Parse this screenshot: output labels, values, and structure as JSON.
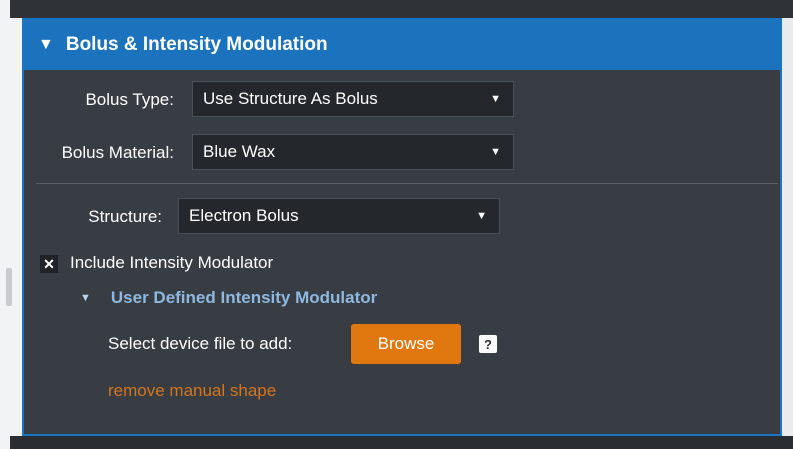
{
  "panel": {
    "title": "Bolus & Intensity Modulation",
    "collapse_icon": "triangle-down-icon"
  },
  "bolus_type": {
    "label": "Bolus Type:",
    "value": "Use Structure As Bolus"
  },
  "bolus_material": {
    "label": "Bolus Material:",
    "value": "Blue Wax"
  },
  "structure": {
    "label": "Structure:",
    "value": "Electron Bolus"
  },
  "include_modulator": {
    "checked": true,
    "label": "Include Intensity Modulator"
  },
  "modulator": {
    "title": "User Defined Intensity Modulator",
    "device_label": "Select device file to add:",
    "browse_label": "Browse",
    "help_label": "?",
    "remove_link": "remove manual shape"
  },
  "colors": {
    "header_blue": "#1b73bd",
    "panel_bg": "#383d43",
    "browse_orange": "#e1780f",
    "link_orange": "#d2761e",
    "sub_header_blue": "#8fb8e0"
  }
}
